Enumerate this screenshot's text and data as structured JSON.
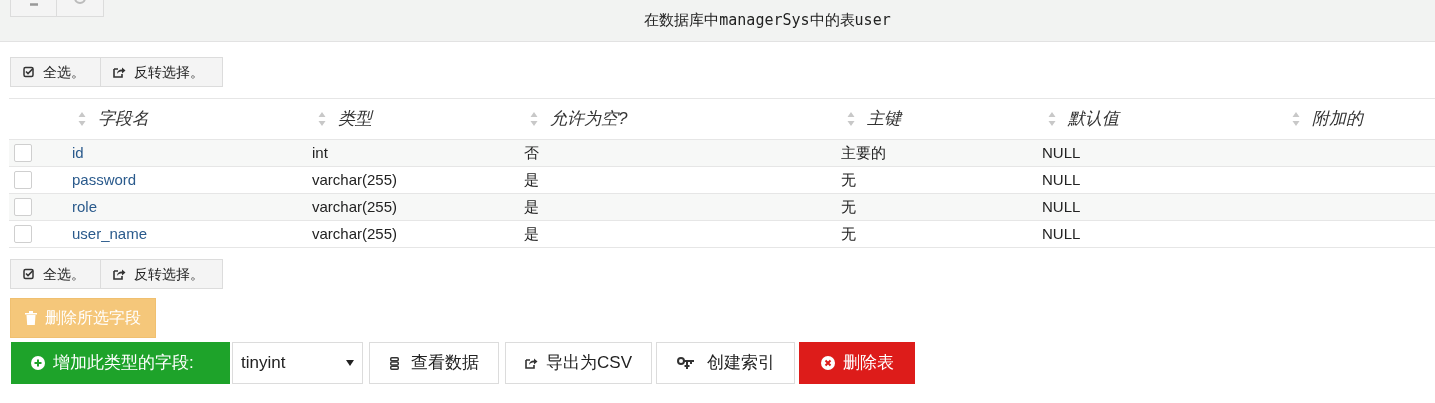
{
  "header": {
    "title": "在数据库中managerSys中的表user"
  },
  "select_toolbar_top": {
    "select_all": "全选。",
    "invert": "反转选择。"
  },
  "table": {
    "columns": [
      "字段名",
      "类型",
      "允许为空?",
      "主键",
      "默认值",
      "附加的"
    ],
    "rows": [
      {
        "checked": false,
        "cells": [
          "id",
          "int",
          "否",
          "主要的",
          "NULL",
          ""
        ]
      },
      {
        "checked": false,
        "cells": [
          "password",
          "varchar(255)",
          "是",
          "无",
          "NULL",
          ""
        ]
      },
      {
        "checked": false,
        "cells": [
          "role",
          "varchar(255)",
          "是",
          "无",
          "NULL",
          ""
        ]
      },
      {
        "checked": false,
        "cells": [
          "user_name",
          "varchar(255)",
          "是",
          "无",
          "NULL",
          ""
        ]
      }
    ]
  },
  "select_toolbar_bottom": {
    "select_all": "全选。",
    "invert": "反转选择。"
  },
  "delete_selected": {
    "label": "删除所选字段",
    "disabled": true
  },
  "actions": {
    "add_field": "增加此类型的字段:",
    "type_select": "tinyint",
    "view_data": "查看数据",
    "export_csv": "导出为CSV",
    "create_index": "创建索引",
    "drop_table": "删除表"
  }
}
